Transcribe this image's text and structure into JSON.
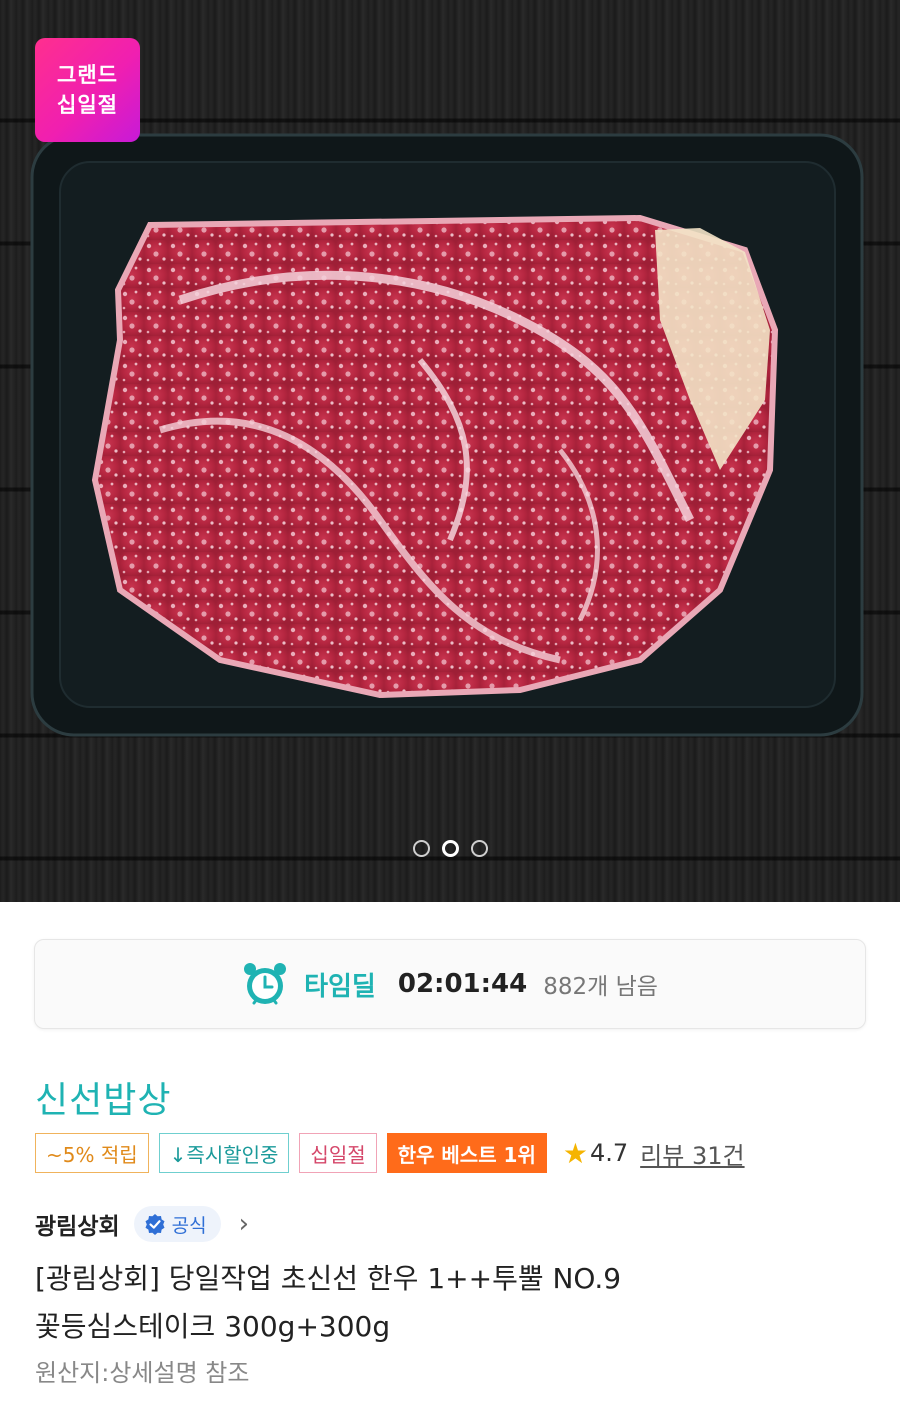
{
  "hero": {
    "image_description_icon": "raw-steak-in-tray-image",
    "promo_badge": "그랜드\n십일절",
    "carousel": {
      "count": 3,
      "active_index": 1
    }
  },
  "timedeal": {
    "icon": "alarm-clock-icon",
    "label": "타임딜",
    "countdown": "02:01:44",
    "remaining": "882개 남음"
  },
  "product": {
    "brand": "신선밥상",
    "tags": {
      "points": "~5% 적립",
      "instant_discount": "↓즉시할인중",
      "event": "십일절",
      "best": "한우 베스트 1위"
    },
    "rating": "4.7",
    "reviews": "리뷰 31건",
    "seller": "광림상회",
    "official_label": "공식",
    "title_line1": "[광림상회] 당일작업 초신선 한우 1++투뿔 NO.9",
    "title_line2": "꽃등심스테이크 300g+300g",
    "origin": "원산지:상세설명 참조"
  },
  "colors": {
    "accent_teal": "#1fb3b3",
    "best_orange": "#ff6b1a",
    "promo_pink": "#ff2f8e",
    "star": "#f5b400"
  }
}
